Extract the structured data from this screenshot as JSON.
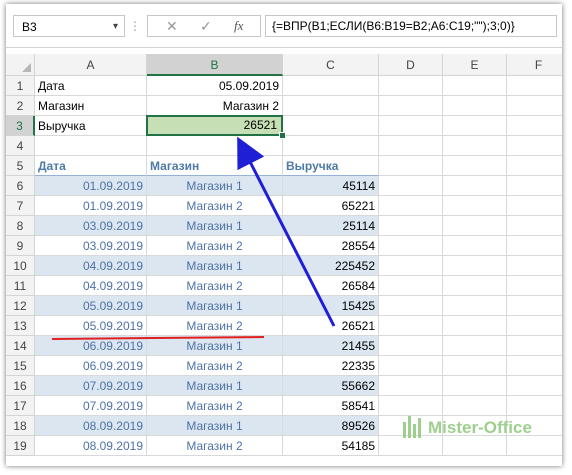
{
  "namebox": {
    "value": "B3"
  },
  "formula_bar": {
    "formula": "{=ВПР(B1;ЕСЛИ(B6:B19=B2;A6:C19;\"\");3;0)}",
    "fx_label": "fx"
  },
  "columns": [
    "A",
    "B",
    "C",
    "D",
    "E",
    "F"
  ],
  "rows": [
    "1",
    "2",
    "3",
    "4",
    "5",
    "6",
    "7",
    "8",
    "9",
    "10",
    "11",
    "12",
    "13",
    "14",
    "15",
    "16",
    "17",
    "18",
    "19"
  ],
  "lookup": {
    "date_label": "Дата",
    "date_value": "05.09.2019",
    "store_label": "Магазин",
    "store_value": "Магазин 2",
    "revenue_label": "Выручка",
    "revenue_value": "26521"
  },
  "table": {
    "headers": [
      "Дата",
      "Магазин",
      "Выручка"
    ],
    "rows": [
      [
        "01.09.2019",
        "Магазин 1",
        "45114"
      ],
      [
        "01.09.2019",
        "Магазин 2",
        "65221"
      ],
      [
        "03.09.2019",
        "Магазин 1",
        "25114"
      ],
      [
        "03.09.2019",
        "Магазин 2",
        "28554"
      ],
      [
        "04.09.2019",
        "Магазин 1",
        "225452"
      ],
      [
        "04.09.2019",
        "Магазин 2",
        "26584"
      ],
      [
        "05.09.2019",
        "Магазин 1",
        "15425"
      ],
      [
        "05.09.2019",
        "Магазин 2",
        "26521"
      ],
      [
        "06.09.2019",
        "Магазин 1",
        "21455"
      ],
      [
        "06.09.2019",
        "Магазин 2",
        "22335"
      ],
      [
        "07.09.2019",
        "Магазин 1",
        "55662"
      ],
      [
        "07.09.2019",
        "Магазин 2",
        "58541"
      ],
      [
        "08.09.2019",
        "Магазин 1",
        "89526"
      ],
      [
        "08.09.2019",
        "Магазин 2",
        "54185"
      ]
    ]
  },
  "annotation": {
    "arrow_color": "#1f1fd6",
    "underline_color": "#e02020"
  },
  "watermark": {
    "text": "Mister-Office"
  }
}
